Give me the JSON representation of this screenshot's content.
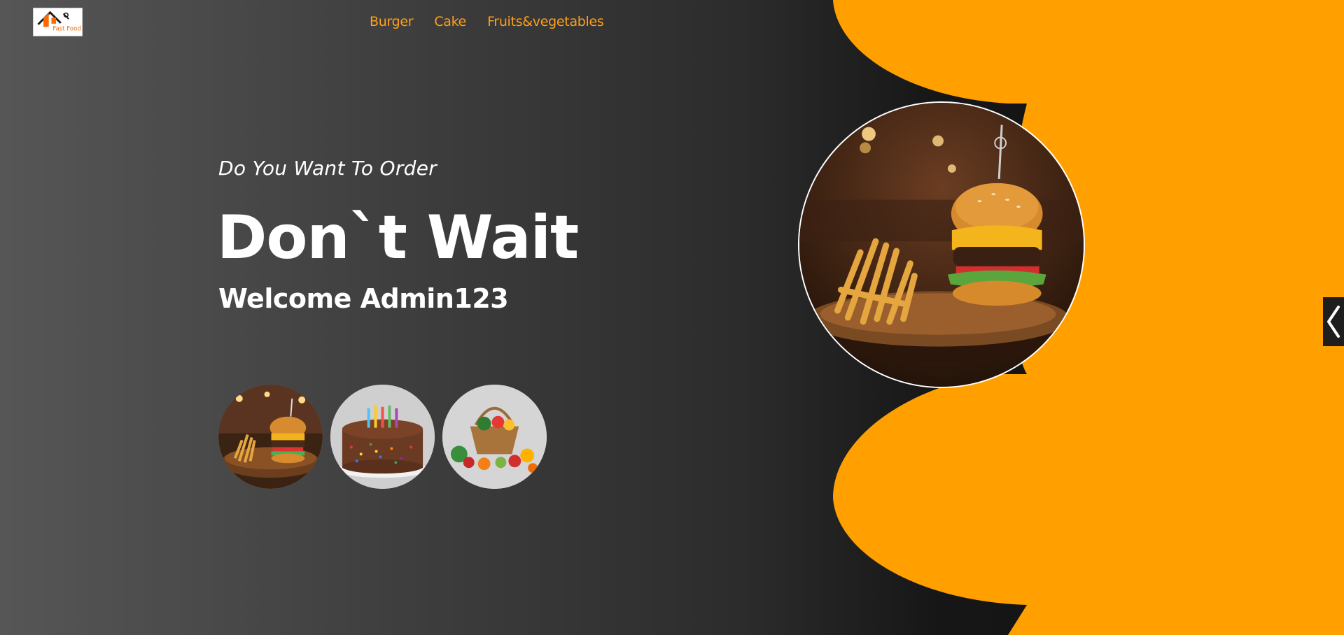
{
  "logo": {
    "text": "Fast Food",
    "icon": "house-logo-icon"
  },
  "nav": {
    "items": [
      {
        "label": "Burger"
      },
      {
        "label": "Cake"
      },
      {
        "label": "Fruits&vegetables"
      }
    ]
  },
  "hero": {
    "subtitle": "Do You Want To Order",
    "headline": "Don`t Wait",
    "welcome": "Welcome Admin123"
  },
  "thumbnails": [
    {
      "name": "burger-thumbnail",
      "icon": "burger-image"
    },
    {
      "name": "cake-thumbnail",
      "icon": "cake-image"
    },
    {
      "name": "fruits-vegetables-thumbnail",
      "icon": "fruit-basket-image"
    }
  ],
  "featured_image": {
    "icon": "burger-fries-plate-image"
  },
  "side_tab": {
    "icon": "chevron-left-icon"
  },
  "colors": {
    "accent": "#ffa000",
    "nav_text": "#ff9f1a",
    "text": "#ffffff",
    "background_dark": "#1a1a1a",
    "background_light": "#565656"
  }
}
